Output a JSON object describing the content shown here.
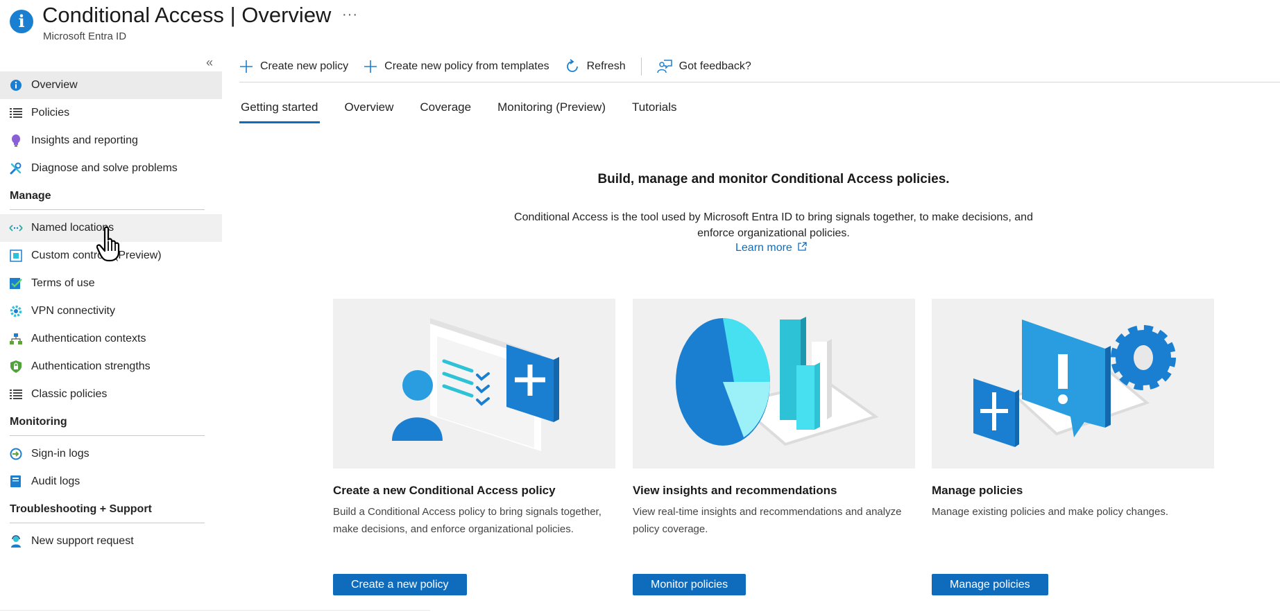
{
  "header": {
    "title_main": "Conditional Access",
    "title_sep": "|",
    "title_section": "Overview",
    "more_label": "···",
    "subtitle": "Microsoft Entra ID",
    "app_icon_letter": "i"
  },
  "sidebar": {
    "collapse_label": "«",
    "top_items": [
      {
        "label": "Overview",
        "icon": "info-icon"
      },
      {
        "label": "Policies",
        "icon": "list-icon"
      },
      {
        "label": "Insights and reporting",
        "icon": "lightbulb-icon"
      },
      {
        "label": "Diagnose and solve problems",
        "icon": "wrench-icon"
      }
    ],
    "manage": {
      "heading": "Manage",
      "items": [
        {
          "label": "Named locations",
          "icon": "location-icon"
        },
        {
          "label": "Custom controls (Preview)",
          "icon": "custom-controls-icon"
        },
        {
          "label": "Terms of use",
          "icon": "checklist-icon"
        },
        {
          "label": "VPN connectivity",
          "icon": "gear-icon"
        },
        {
          "label": "Authentication contexts",
          "icon": "hierarchy-icon"
        },
        {
          "label": "Authentication strengths",
          "icon": "shield-lock-icon"
        },
        {
          "label": "Classic policies",
          "icon": "list-icon"
        }
      ]
    },
    "monitoring": {
      "heading": "Monitoring",
      "items": [
        {
          "label": "Sign-in logs",
          "icon": "signin-icon"
        },
        {
          "label": "Audit logs",
          "icon": "book-icon"
        }
      ]
    },
    "troubleshooting": {
      "heading": "Troubleshooting + Support",
      "items": [
        {
          "label": "New support request",
          "icon": "support-person-icon"
        }
      ]
    }
  },
  "toolbar": {
    "create_policy": "Create new policy",
    "create_from_templates": "Create new policy from templates",
    "refresh": "Refresh",
    "feedback": "Got feedback?"
  },
  "tabs": [
    "Getting started",
    "Overview",
    "Coverage",
    "Monitoring (Preview)",
    "Tutorials"
  ],
  "main": {
    "hero_title": "Build, manage and monitor Conditional Access policies.",
    "hero_desc": "Conditional Access is the tool used by Microsoft Entra ID to bring signals together, to make decisions, and enforce organizational policies.",
    "learn_more": "Learn more",
    "cards": [
      {
        "title": "Create a new Conditional Access policy",
        "desc": "Build a Conditional Access policy to bring signals together, make decisions, and enforce organizational policies.",
        "button": "Create a new policy"
      },
      {
        "title": "View insights and recommendations",
        "desc": "View real-time insights and recommendations and analyze policy coverage.",
        "button": "Monitor policies"
      },
      {
        "title": "Manage policies",
        "desc": "Manage existing policies and make policy changes.",
        "button": "Manage policies"
      }
    ]
  },
  "colors": {
    "accent": "#0f6cbd",
    "selected_nav_bg": "#ebebeb",
    "card_bg": "#f0f0f0"
  }
}
